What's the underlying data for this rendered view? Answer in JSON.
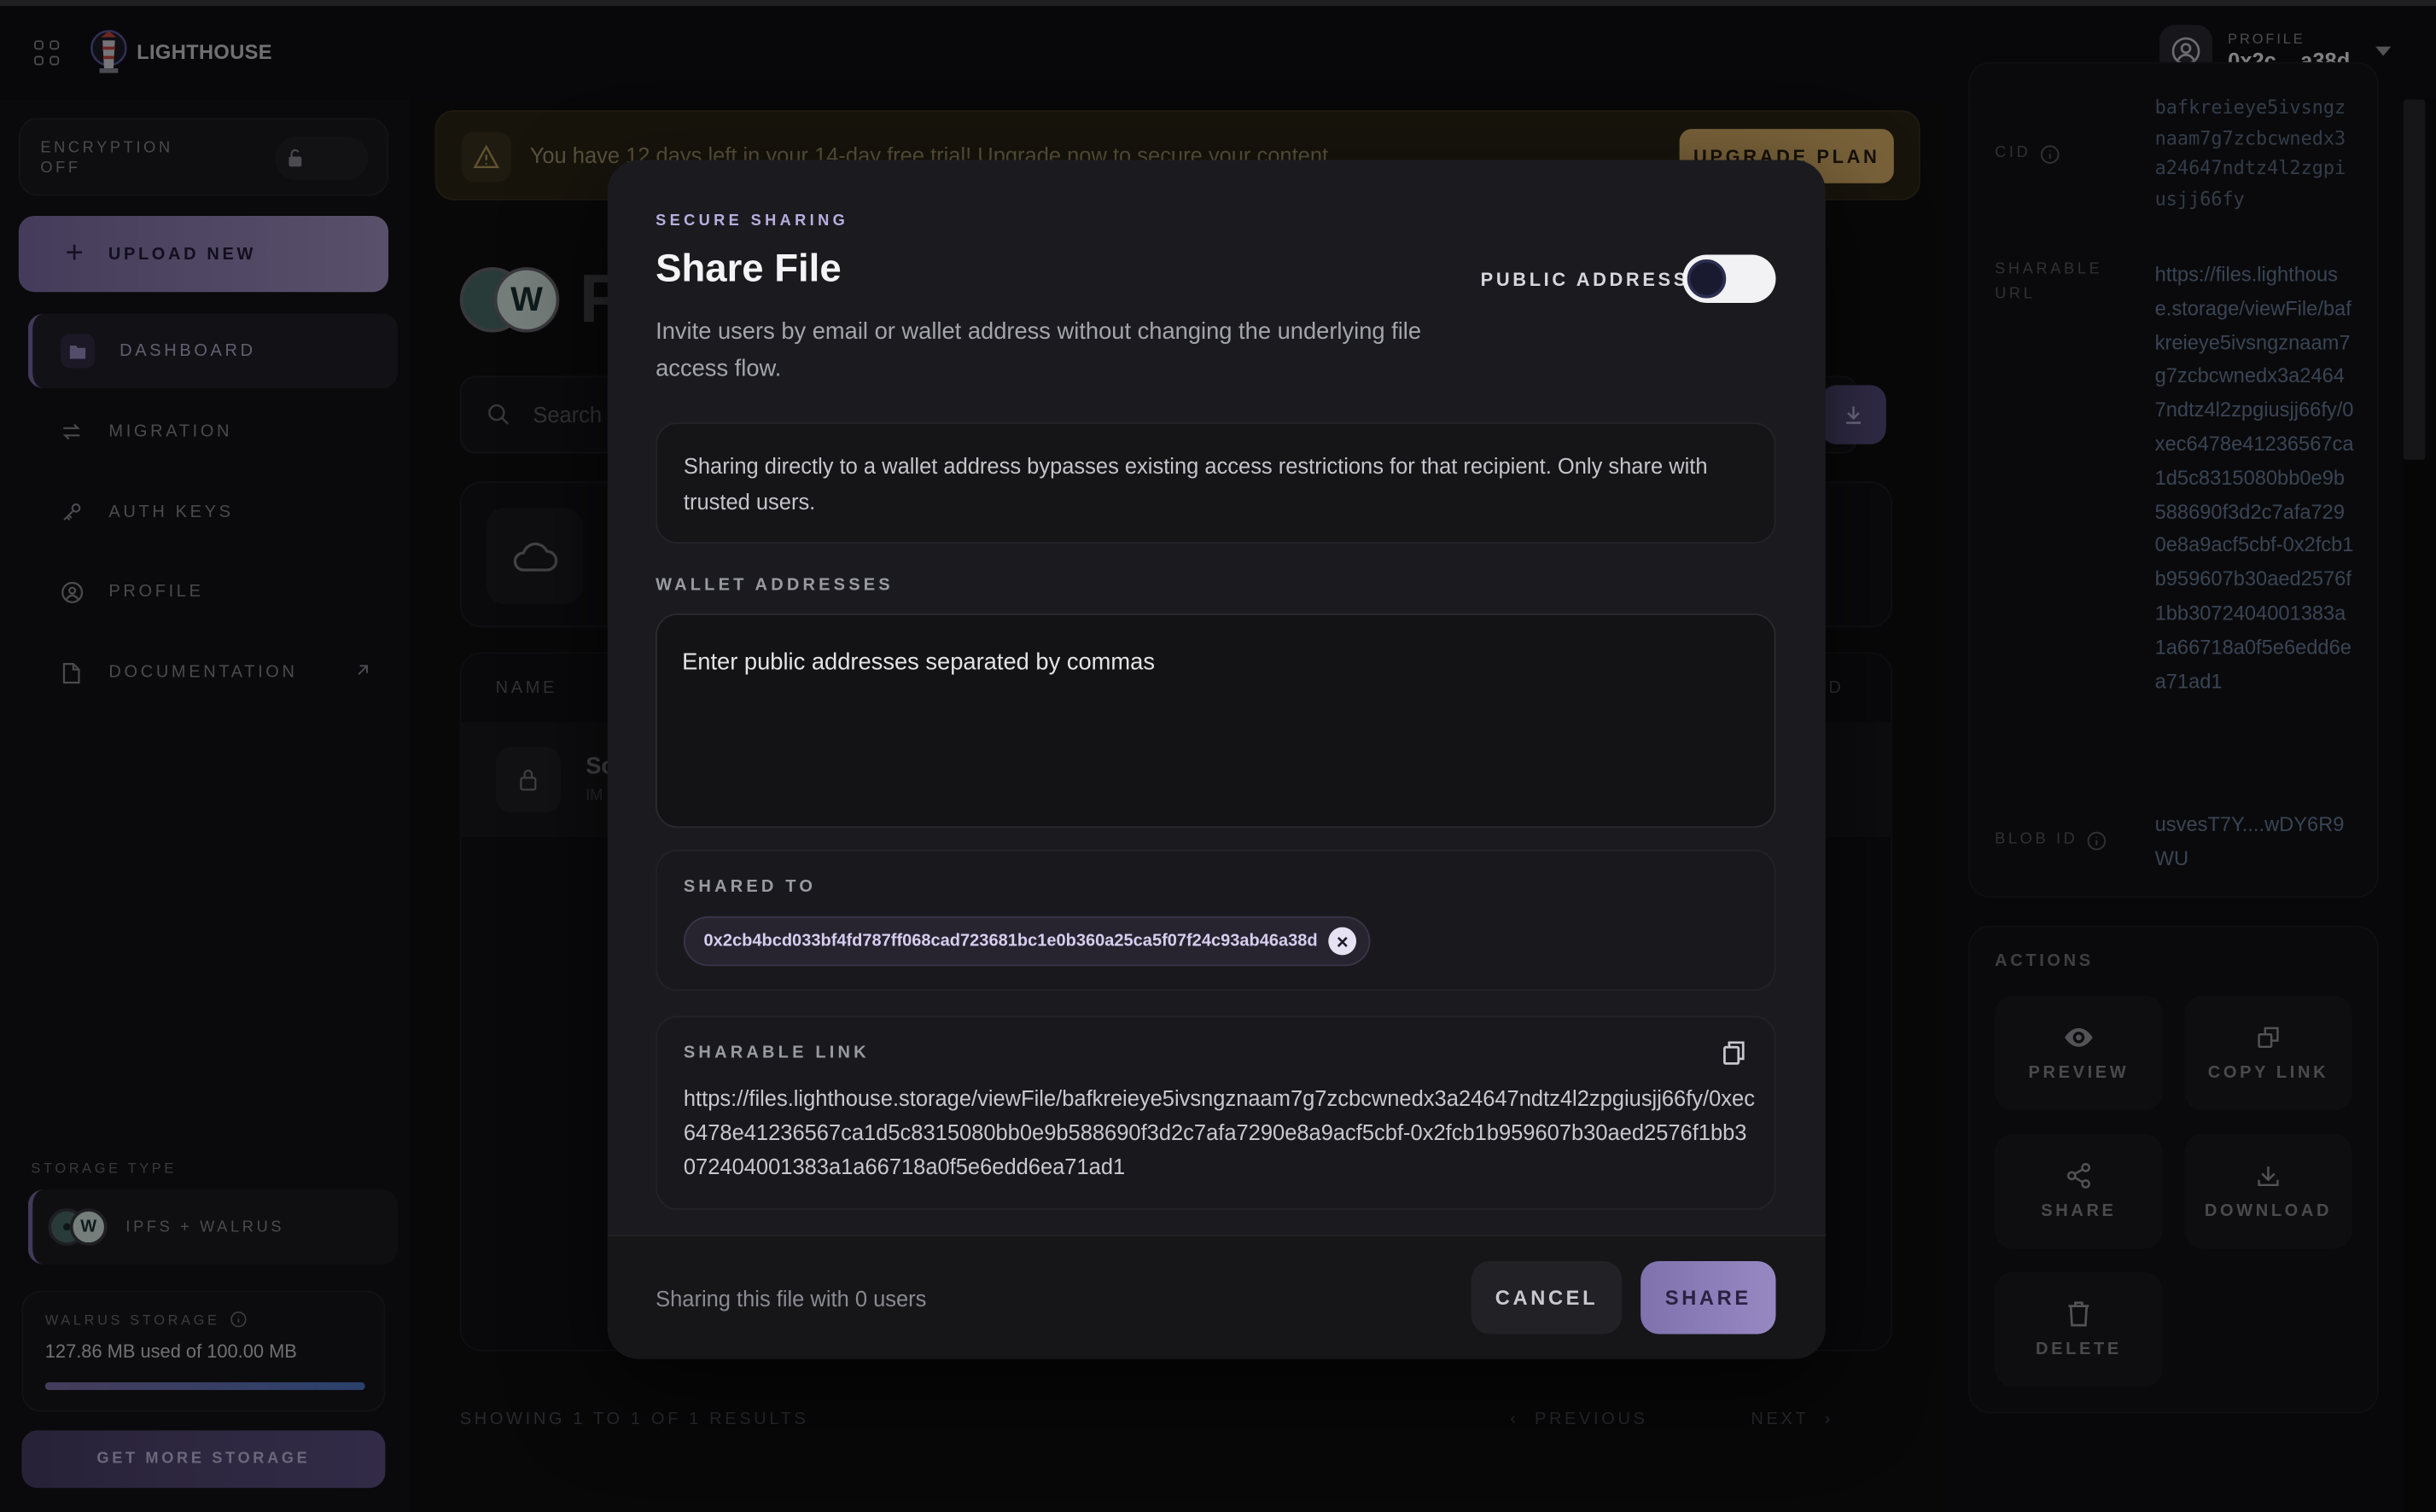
{
  "app": {
    "brand": "LIGHTHOUSE"
  },
  "profile": {
    "label": "PROFILE",
    "address": "0x2c....a38d"
  },
  "sidebar": {
    "encryption_label": "ENCRYPTION OFF",
    "upload_label": "UPLOAD NEW",
    "items": [
      {
        "label": "DASHBOARD",
        "icon": "folder-icon"
      },
      {
        "label": "MIGRATION",
        "icon": "arrows-icon"
      },
      {
        "label": "AUTH KEYS",
        "icon": "key-icon"
      },
      {
        "label": "PROFILE",
        "icon": "user-circle-icon"
      },
      {
        "label": "DOCUMENTATION",
        "icon": "document-icon"
      }
    ],
    "storage_type_label": "STORAGE TYPE",
    "storage_type_value": "IPFS + WALRUS",
    "walrus_label": "WALRUS STORAGE",
    "walrus_usage": "127.86 MB used of 100.00 MB",
    "walrus_usage_fraction": 1.0,
    "get_more_label": "GET MORE STORAGE"
  },
  "banner": {
    "message": "You have 12 days left in your 14-day free trial! Upgrade now to secure your content.",
    "button": "UPGRADE PLAN"
  },
  "main": {
    "page_title": "F",
    "search_placeholder": "Search",
    "table_header_name": "NAME",
    "table_header_right": "D",
    "row_name": "Sc",
    "row_sub": "IM",
    "showing": "SHOWING 1 TO 1 OF 1 RESULTS",
    "previous": "PREVIOUS",
    "next": "NEXT"
  },
  "details": {
    "cid_label": "CID",
    "cid_value": "bafkreieye5ivsngznaam7g7zcbcwnedx3a24647ndtz4l2zgpiusjj66fy",
    "url_label": "SHARABLE URL",
    "url_value": "https://files.lighthouse.storage/viewFile/bafkreieye5ivsngznaam7g7zcbcwnedx3a24647ndtz4l2zpgiusjj66fy/0xec6478e41236567ca1d5c8315080bb0e9b588690f3d2c7afa7290e8a9acf5cbf-0x2fcb1b959607b30aed2576f1bb3072404001383a1a66718a0f5e6edd6ea71ad1",
    "blob_label": "BLOB ID",
    "blob_value": "usvesT7Y....wDY6R9WU"
  },
  "actions": {
    "title": "ACTIONS",
    "preview": "PREVIEW",
    "copy_link": "COPY LINK",
    "share": "SHARE",
    "download": "DOWNLOAD",
    "delete": "DELETE"
  },
  "modal": {
    "eyebrow": "SECURE SHARING",
    "title": "Share File",
    "description": "Invite users by email or wallet address without changing the underlying file access flow.",
    "public_address_label": "PUBLIC ADDRESS",
    "public_address_on": false,
    "warning": "Sharing directly to a wallet address bypasses existing access restrictions for that recipient. Only share with trusted users.",
    "wallet_label": "WALLET ADDRESSES",
    "wallet_placeholder": "Enter public addresses separated by commas",
    "shared_to_label": "SHARED TO",
    "shared_to": [
      "0x2cb4bcd033bf4fd787ff068cad723681bc1e0b360a25ca5f07f24c93ab46a38d"
    ],
    "link_label": "SHARABLE LINK",
    "link_value": "https://files.lighthouse.storage/viewFile/bafkreieye5ivsngznaam7g7zcbcwnedx3a24647ndtz4l2zpgiusjj66fy/0xec6478e41236567ca1d5c8315080bb0e9b588690f3d2c7afa7290e8a9acf5cbf-0x2fcb1b959607b30aed2576f1bb3072404001383a1a66718a0f5e6edd6ea71ad1",
    "status": "Sharing this file with 0 users",
    "cancel": "CANCEL",
    "share": "SHARE"
  }
}
